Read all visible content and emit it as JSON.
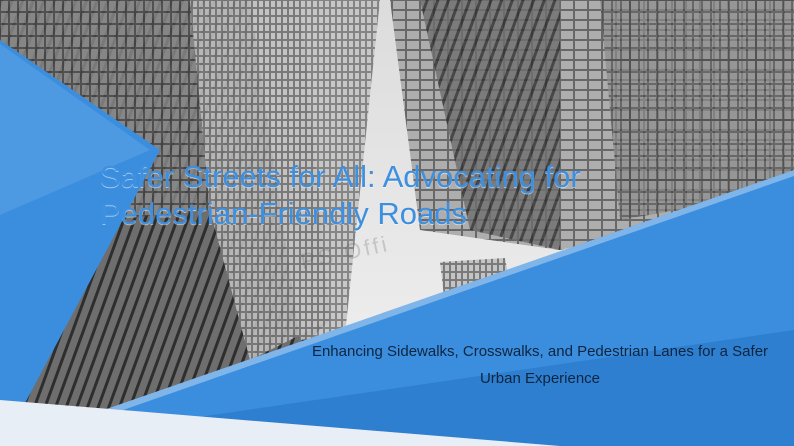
{
  "slide": {
    "title": "Safer Streets for All: Advocating for Pedestrian-Friendly Roads",
    "subtitle": "Enhancing Sidewalks, Crosswalks, and Pedestrian Lanes for a Safer Urban Experience",
    "watermark": "PS Offi",
    "colors": {
      "accent": "#3b8ede",
      "title": "#3d8fe0",
      "subtitle": "#0e2540"
    },
    "background_image": "skyscrapers-looking-up-grayscale"
  }
}
